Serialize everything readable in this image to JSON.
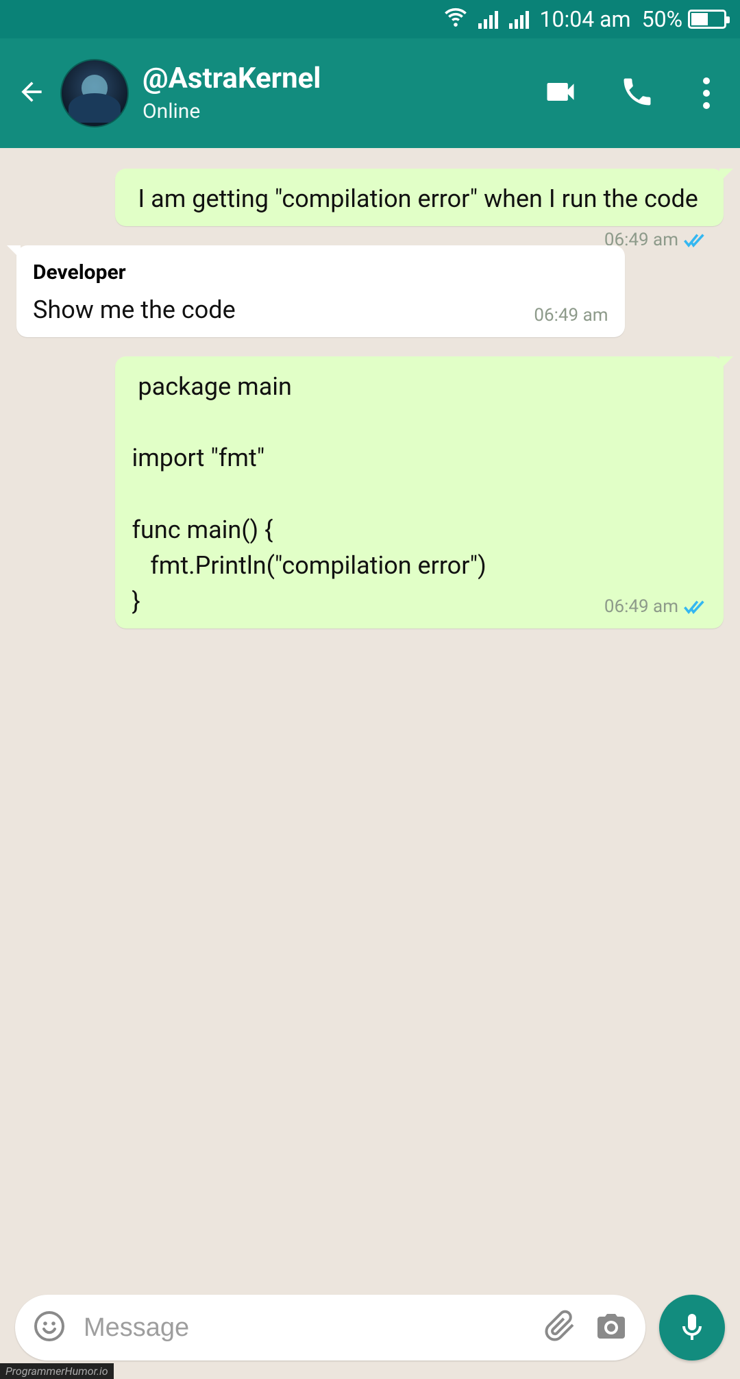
{
  "status_bar": {
    "time": "10:04 am",
    "battery_pct": "50%"
  },
  "header": {
    "name": "@AstraKernel",
    "status": "Online"
  },
  "messages": [
    {
      "side": "out",
      "body": " I am getting \"compilation error\" when I run the code",
      "time": "06:49 am",
      "read": true
    },
    {
      "side": "in",
      "sender": "Developer",
      "body": "Show me the code",
      "time": "06:49 am"
    },
    {
      "side": "out",
      "body": " package main\n\nimport \"fmt\"\n\nfunc main() {\n   fmt.Println(\"compilation error\")\n}",
      "time": "06:49 am",
      "read": true
    }
  ],
  "footer": {
    "placeholder": "Message"
  },
  "watermark": "ProgrammerHumor.io"
}
